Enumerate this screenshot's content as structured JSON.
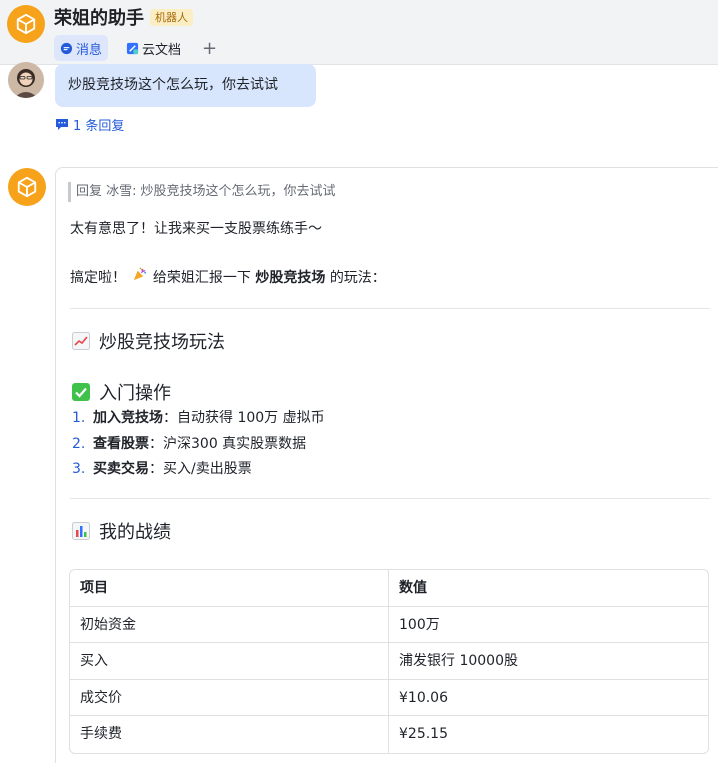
{
  "header": {
    "title": "荣姐的助手",
    "badge": "机器人",
    "tabs": [
      {
        "label": "消息",
        "icon": "chat-bubble-icon",
        "active": true
      },
      {
        "label": "云文档",
        "icon": "cloud-doc-icon",
        "active": false
      }
    ],
    "add_tab_label": "+"
  },
  "user_message": {
    "text": "炒股竞技场这个怎么玩，你去试试",
    "reply_count": "1 条回复"
  },
  "bot_reply": {
    "quote_label": "回复 冰雪:",
    "quote_text": "炒股竞技场这个怎么玩，你去试试",
    "intro": "太有意思了！让我来买一支股票练练手～",
    "report_prefix": "搞定啦！",
    "report_middle": "给荣姐汇报一下",
    "report_bold": "炒股竞技场",
    "report_suffix": "的玩法：",
    "section1": {
      "icon": "chart-up-icon",
      "title": "炒股竞技场玩法"
    },
    "section2": {
      "icon": "checkmark-icon",
      "title": "入门操作"
    },
    "steps": [
      {
        "num": "1.",
        "bold": "加入竞技场",
        "text": "：自动获得 100万 虚拟币"
      },
      {
        "num": "2.",
        "bold": "查看股票",
        "text": "：沪深300 真实股票数据"
      },
      {
        "num": "3.",
        "bold": "买卖交易",
        "text": "：买入/卖出股票"
      }
    ],
    "section3": {
      "icon": "bar-chart-icon",
      "title": "我的战绩"
    },
    "table": {
      "headers": [
        "项目",
        "数值"
      ],
      "rows": [
        [
          "初始资金",
          "100万"
        ],
        [
          "买入",
          "浦发银行 10000股"
        ],
        [
          "成交价",
          "¥10.06"
        ],
        [
          "手续费",
          "¥25.15"
        ]
      ]
    }
  },
  "colors": {
    "accent": "#245bdb",
    "bot_avatar": "#f7a21b",
    "user_bubble": "#d8e6fd"
  }
}
